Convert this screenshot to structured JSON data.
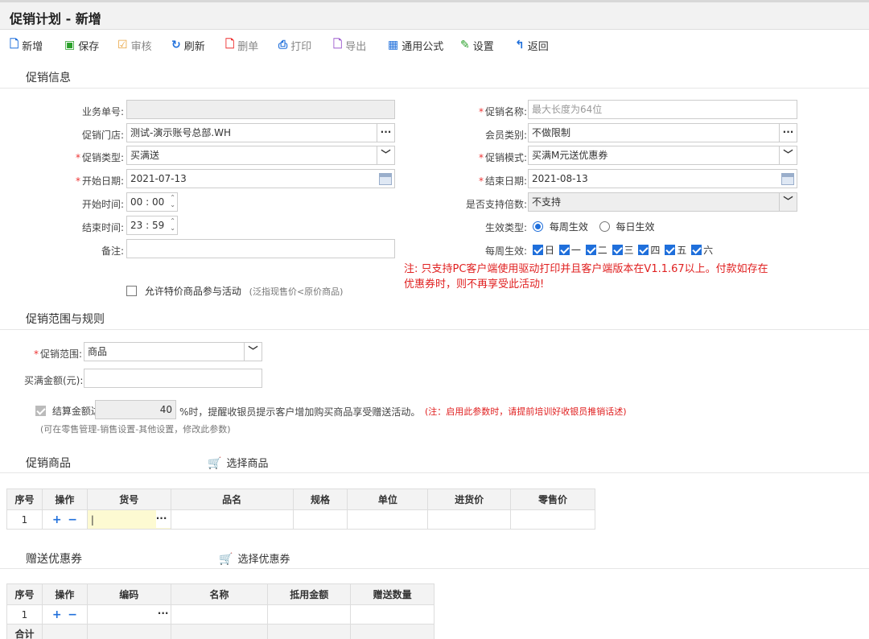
{
  "window": {
    "title": "促销计划 - 新增"
  },
  "toolbar": {
    "new": "新增",
    "save": "保存",
    "audit": "审核",
    "refresh": "刷新",
    "delete": "删单",
    "print": "打印",
    "export": "导出",
    "formula": "通用公式",
    "settings": "设置",
    "back": "返回"
  },
  "info": {
    "heading": "促销信息",
    "order_no_label": "业务单号:",
    "store_label": "促销门店:",
    "store_value": "测试-演示账号总部.WH",
    "type_label": "促销类型:",
    "type_value": "买满送",
    "start_date_label": "开始日期:",
    "start_date_value": "2021-07-13",
    "start_time_label": "开始时间:",
    "start_time_value": "00 : 00",
    "end_time_label": "结束时间:",
    "end_time_value": "23 : 59",
    "remark_label": "备注:",
    "name_label": "促销名称:",
    "name_placeholder": "最大长度为64位",
    "member_label": "会员类别:",
    "member_value": "不做限制",
    "mode_label": "促销模式:",
    "mode_value": "买满M元送优惠券",
    "end_date_label": "结束日期:",
    "end_date_value": "2021-08-13",
    "multiple_label": "是否支持倍数:",
    "multiple_value": "不支持",
    "effect_type_label": "生效类型:",
    "effect_weekly": "每周生效",
    "effect_daily": "每日生效",
    "weekly_label": "每周生效:",
    "weekdays": [
      "日",
      "一",
      "二",
      "三",
      "四",
      "五",
      "六"
    ],
    "note_line1": "注: 只支持PC客户端使用驱动打印并且客户端版本在V1.1.67以上。付款如存在",
    "note_line2": "优惠券时，则不再享受此活动!",
    "allow_special_label": "允许特价商品参与活动",
    "allow_special_hint": "(泛指现售价<原价商品)"
  },
  "scope": {
    "heading": "促销范围与规则",
    "scope_label": "促销范围:",
    "scope_value": "商品",
    "amount_label": "买满金额(元):",
    "settle_label": "结算金额达",
    "settle_value": "40",
    "settle_suffix": "%时，提醒收银员提示客户增加购买商品享受赠送活动。",
    "settle_note": "(注：启用此参数时，请提前培训好收银员推销话述)",
    "settle_hint": "(可在零售管理-销售设置-其他设置，修改此参数)"
  },
  "products": {
    "heading": "促销商品",
    "select_label": "选择商品",
    "columns": [
      "序号",
      "操作",
      "货号",
      "品名",
      "规格",
      "单位",
      "进货价",
      "零售价"
    ],
    "rows": [
      {
        "no": "1"
      }
    ]
  },
  "coupons": {
    "heading": "赠送优惠券",
    "select_label": "选择优惠券",
    "columns": [
      "序号",
      "操作",
      "编码",
      "名称",
      "抵用金额",
      "赠送数量"
    ],
    "rows": [
      {
        "no": "1"
      }
    ],
    "total_label": "合计"
  }
}
